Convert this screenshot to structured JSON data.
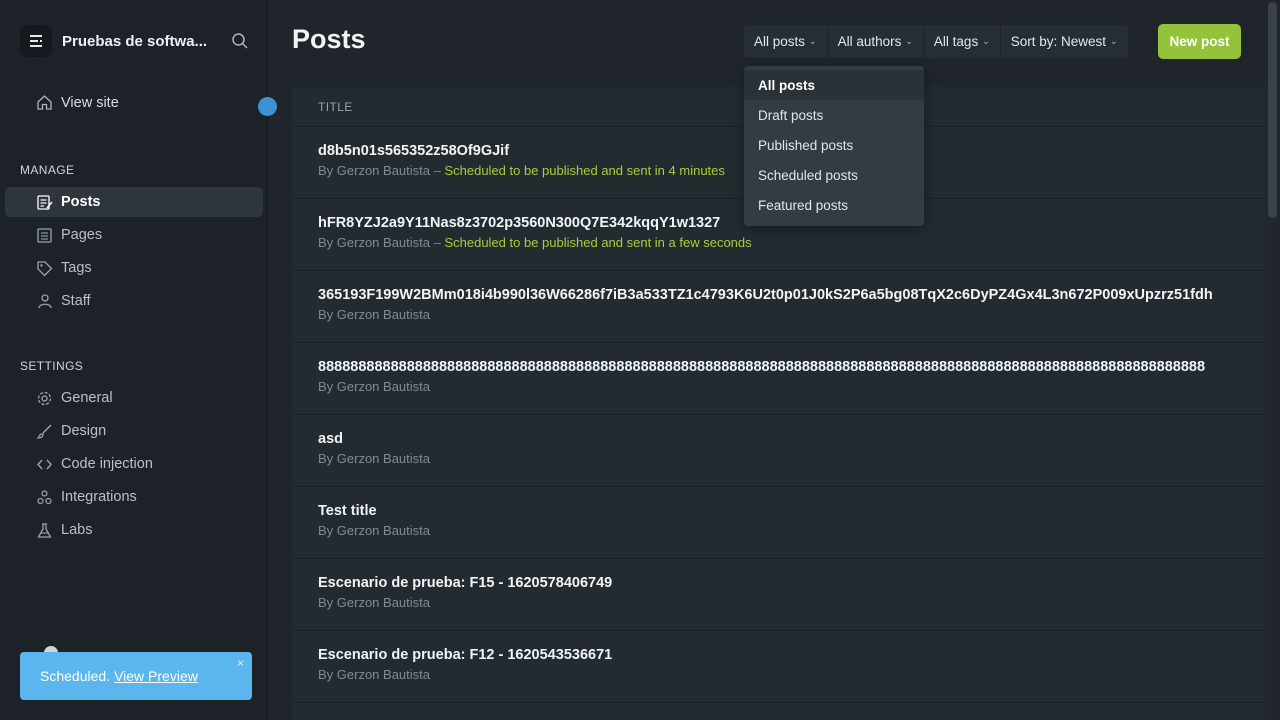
{
  "sidebar": {
    "site_title": "Pruebas de softwa...",
    "view_site": "View site",
    "manage_title": "MANAGE",
    "manage_items": [
      {
        "label": "Posts",
        "icon": "posts-icon"
      },
      {
        "label": "Pages",
        "icon": "pages-icon"
      },
      {
        "label": "Tags",
        "icon": "tag-icon"
      },
      {
        "label": "Staff",
        "icon": "staff-icon"
      }
    ],
    "settings_title": "SETTINGS",
    "settings_items": [
      {
        "label": "General",
        "icon": "gear-icon"
      },
      {
        "label": "Design",
        "icon": "brush-icon"
      },
      {
        "label": "Code injection",
        "icon": "code-icon"
      },
      {
        "label": "Integrations",
        "icon": "integrations-icon"
      },
      {
        "label": "Labs",
        "icon": "flask-icon"
      }
    ]
  },
  "toast": {
    "text": "Scheduled.",
    "link": "View Preview",
    "close": "×"
  },
  "header": {
    "title": "Posts",
    "filters": [
      "All posts",
      "All authors",
      "All tags",
      "Sort by: Newest"
    ],
    "new_post": "New post"
  },
  "dropdown": {
    "items": [
      "All posts",
      "Draft posts",
      "Published posts",
      "Scheduled posts",
      "Featured posts"
    ],
    "selected": "All posts"
  },
  "table": {
    "column_title": "TITLE",
    "rows": [
      {
        "title": "d8b5n01s565352z58Of9GJif",
        "author": "By Gerzon Bautista",
        "status": "Scheduled to be published and sent in 4 minutes"
      },
      {
        "title": "hFR8YZJ2a9Y11Nas8z3702p3560N300Q7E342kqqY1w1327",
        "author": "By Gerzon Bautista",
        "status": "Scheduled to be published and sent in a few seconds"
      },
      {
        "title": "365193F199W2BMm018i4b990l36W66286f7iB3a533TZ1c4793K6U2t0p01J0kS2P6a5bg08TqX2c6DyPZ4Gx4L3n672P009xUpzrz51fdh",
        "author": "By Gerzon Bautista",
        "status": ""
      },
      {
        "title": "88888888888888888888888888888888888888888888888888888888888888888888888888888888888888888888888888888888888888",
        "author": "By Gerzon Bautista",
        "status": ""
      },
      {
        "title": "asd",
        "author": "By Gerzon Bautista",
        "status": ""
      },
      {
        "title": "Test title",
        "author": "By Gerzon Bautista",
        "status": ""
      },
      {
        "title": "Escenario de prueba: F15 - 1620578406749",
        "author": "By Gerzon Bautista",
        "status": ""
      },
      {
        "title": "Escenario de prueba: F12 - 1620543536671",
        "author": "By Gerzon Bautista",
        "status": ""
      }
    ]
  },
  "colors": {
    "accent_green": "#94c23a",
    "scheduled_text": "#a8cf3a",
    "toast_blue": "#5ab6ec",
    "notification_dot": "#3f92d2"
  }
}
